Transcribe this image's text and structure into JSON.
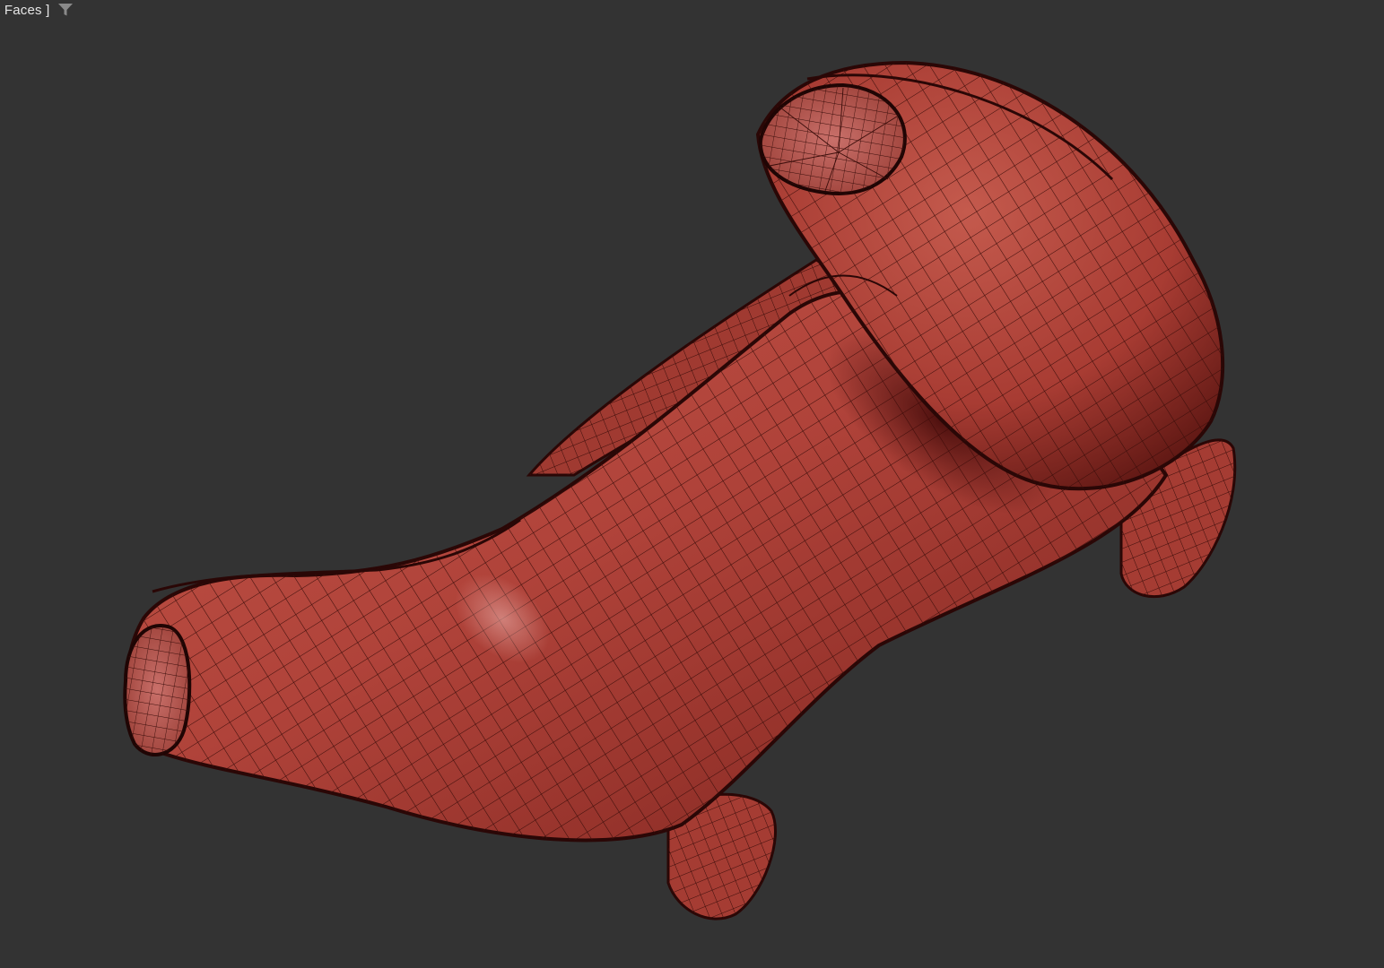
{
  "viewport": {
    "label": "l Faces ]",
    "filter_icon": "filter-icon",
    "background_color": "#333333"
  },
  "model": {
    "object": "controller-grip-mesh",
    "surface_color": "#b3443a",
    "wire_color": "#3a0d0a",
    "display_mode": "edged-faces"
  }
}
